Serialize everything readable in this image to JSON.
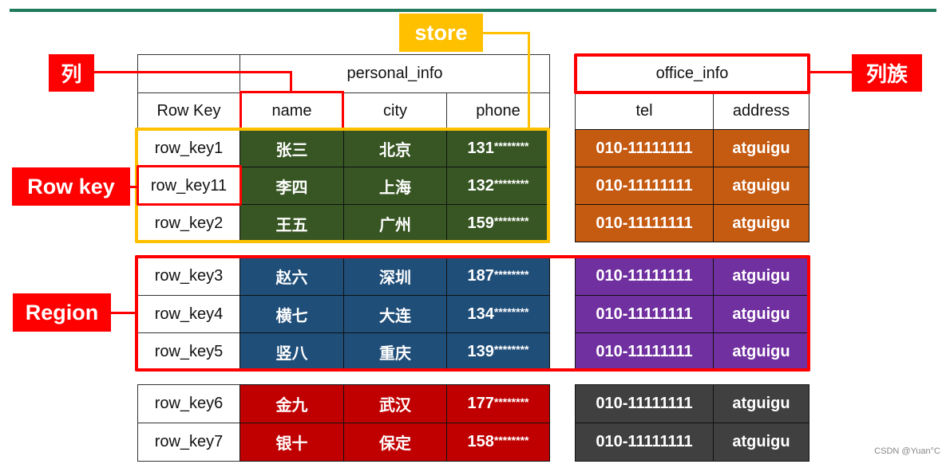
{
  "labels": {
    "column": "列",
    "store": "store",
    "column_family": "列族",
    "row_key": "Row key",
    "region": "Region"
  },
  "colors": {
    "accent_line": "#1f7a5e",
    "label_red": "#ff0000",
    "label_yellow": "#ffc000",
    "group1_personal": "#375623",
    "group1_office": "#c55a11",
    "group2_personal": "#1f4e79",
    "group2_office": "#7030a0",
    "group3_personal": "#c00000",
    "group3_office": "#404040"
  },
  "table": {
    "families": {
      "personal": "personal_info",
      "office": "office_info"
    },
    "headers": {
      "row_key": "Row Key",
      "name": "name",
      "city": "city",
      "phone": "phone",
      "tel": "tel",
      "address": "address"
    },
    "rows": [
      {
        "key": "row_key1",
        "name": "张三",
        "city": "北京",
        "phone_prefix": "131",
        "phone_mask": "********",
        "tel": "010-11111111",
        "address": "atguigu"
      },
      {
        "key": "row_key11",
        "name": "李四",
        "city": "上海",
        "phone_prefix": "132",
        "phone_mask": "********",
        "tel": "010-11111111",
        "address": "atguigu"
      },
      {
        "key": "row_key2",
        "name": "王五",
        "city": "广州",
        "phone_prefix": "159",
        "phone_mask": "********",
        "tel": "010-11111111",
        "address": "atguigu"
      },
      {
        "key": "row_key3",
        "name": "赵六",
        "city": "深圳",
        "phone_prefix": "187",
        "phone_mask": "********",
        "tel": "010-11111111",
        "address": "atguigu"
      },
      {
        "key": "row_key4",
        "name": "横七",
        "city": "大连",
        "phone_prefix": "134",
        "phone_mask": "********",
        "tel": "010-11111111",
        "address": "atguigu"
      },
      {
        "key": "row_key5",
        "name": "竖八",
        "city": "重庆",
        "phone_prefix": "139",
        "phone_mask": "********",
        "tel": "010-11111111",
        "address": "atguigu"
      },
      {
        "key": "row_key6",
        "name": "金九",
        "city": "武汉",
        "phone_prefix": "177",
        "phone_mask": "********",
        "tel": "010-11111111",
        "address": "atguigu"
      },
      {
        "key": "row_key7",
        "name": "银十",
        "city": "保定",
        "phone_prefix": "158",
        "phone_mask": "********",
        "tel": "010-11111111",
        "address": "atguigu"
      }
    ]
  },
  "watermark": "CSDN @Yuan°C"
}
